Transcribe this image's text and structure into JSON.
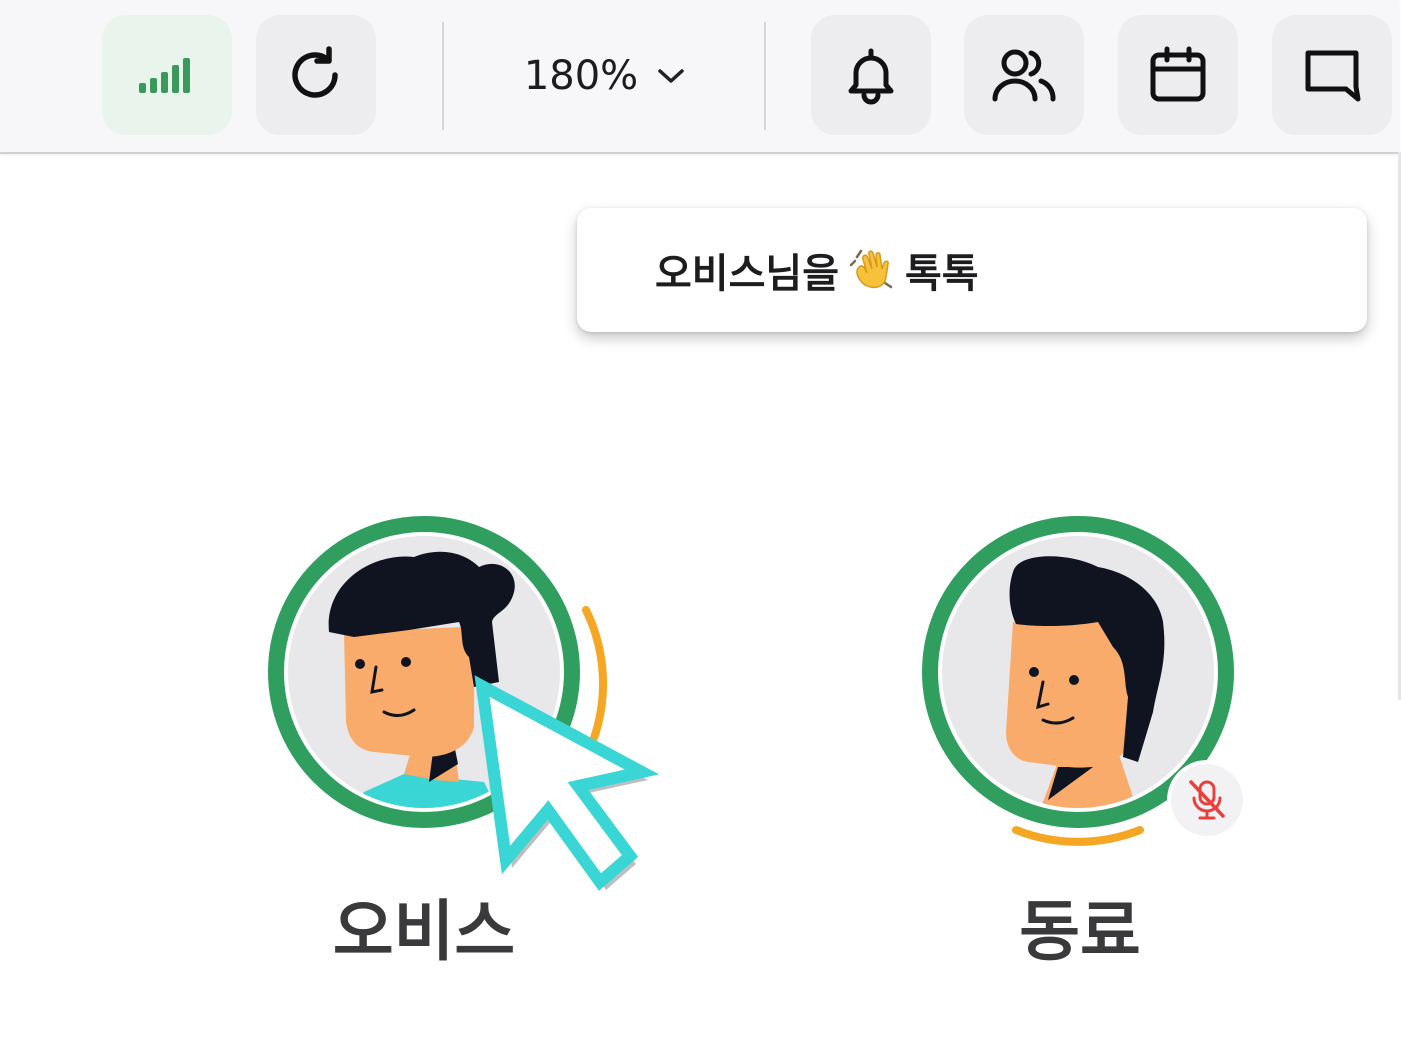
{
  "toolbar": {
    "signal_icon": "signal-strength-icon",
    "refresh_icon": "refresh-icon",
    "zoom_value": "180%",
    "zoom_chevron_icon": "chevron-down-icon",
    "bell_icon": "bell-icon",
    "people_icon": "users-icon",
    "calendar_icon": "calendar-icon",
    "chat_icon": "chat-icon",
    "signal_color": "#3a9a5b"
  },
  "popup": {
    "text_before": "오비스님을",
    "emoji_icon": "waving-hand-icon",
    "text_after": "톡톡"
  },
  "participants": [
    {
      "name": "오비스",
      "ring_color": "#2f9e5e",
      "speaking_arc_color": "#f5a623",
      "muted": false
    },
    {
      "name": "동료",
      "ring_color": "#2f9e5e",
      "speaking_arc_color": "#f5a623",
      "muted": true,
      "mute_icon": "mic-off-icon"
    }
  ],
  "cursor": {
    "icon": "mouse-pointer-icon",
    "color": "#3ad6d6"
  }
}
